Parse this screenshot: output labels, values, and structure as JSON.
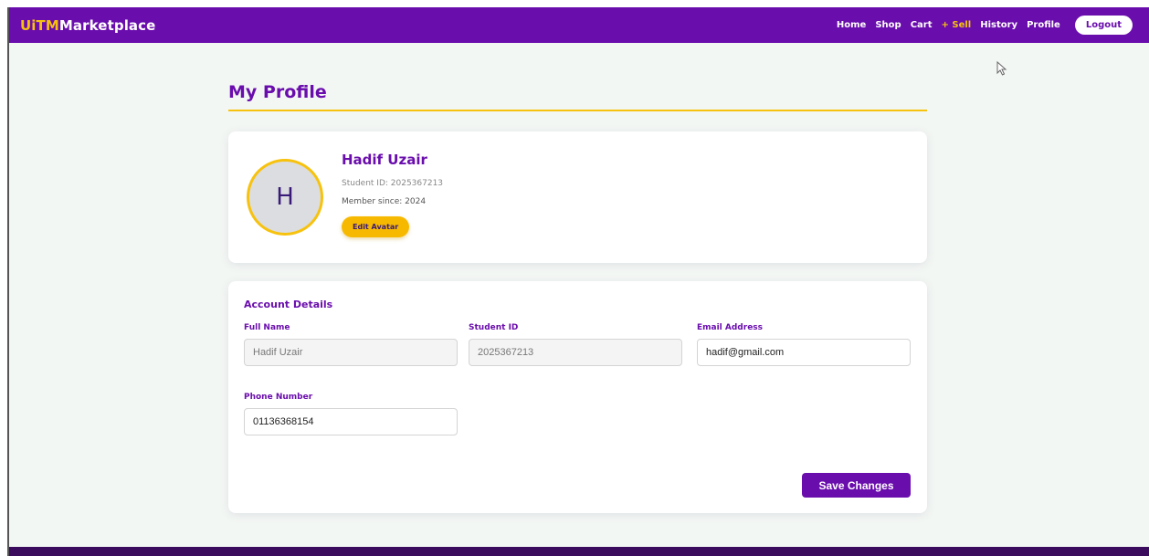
{
  "nav": {
    "brand_accent": "UiTM",
    "brand_rest": "Marketplace",
    "links": [
      "Home",
      "Shop",
      "Cart",
      "+ Sell",
      "History",
      "Profile"
    ],
    "logout": "Logout"
  },
  "page": {
    "title": "My Profile"
  },
  "profile": {
    "initial": "H",
    "name": "Hadif Uzair",
    "student_id": "Student ID: 2025367213",
    "member_since": "Member since: 2024",
    "edit_avatar": "Edit Avatar"
  },
  "account": {
    "title": "Account Details",
    "full_name_label": "Full Name",
    "full_name_value": "Hadif Uzair",
    "student_id_label": "Student ID",
    "student_id_value": "2025367213",
    "email_label": "Email Address",
    "email_value": "hadif@gmail.com",
    "phone_label": "Phone Number",
    "phone_value": "01136368154",
    "save": "Save Changes"
  },
  "colors": {
    "primary": "#6a0dad",
    "accent": "#f7c20e",
    "background": "#f3f7f3"
  }
}
